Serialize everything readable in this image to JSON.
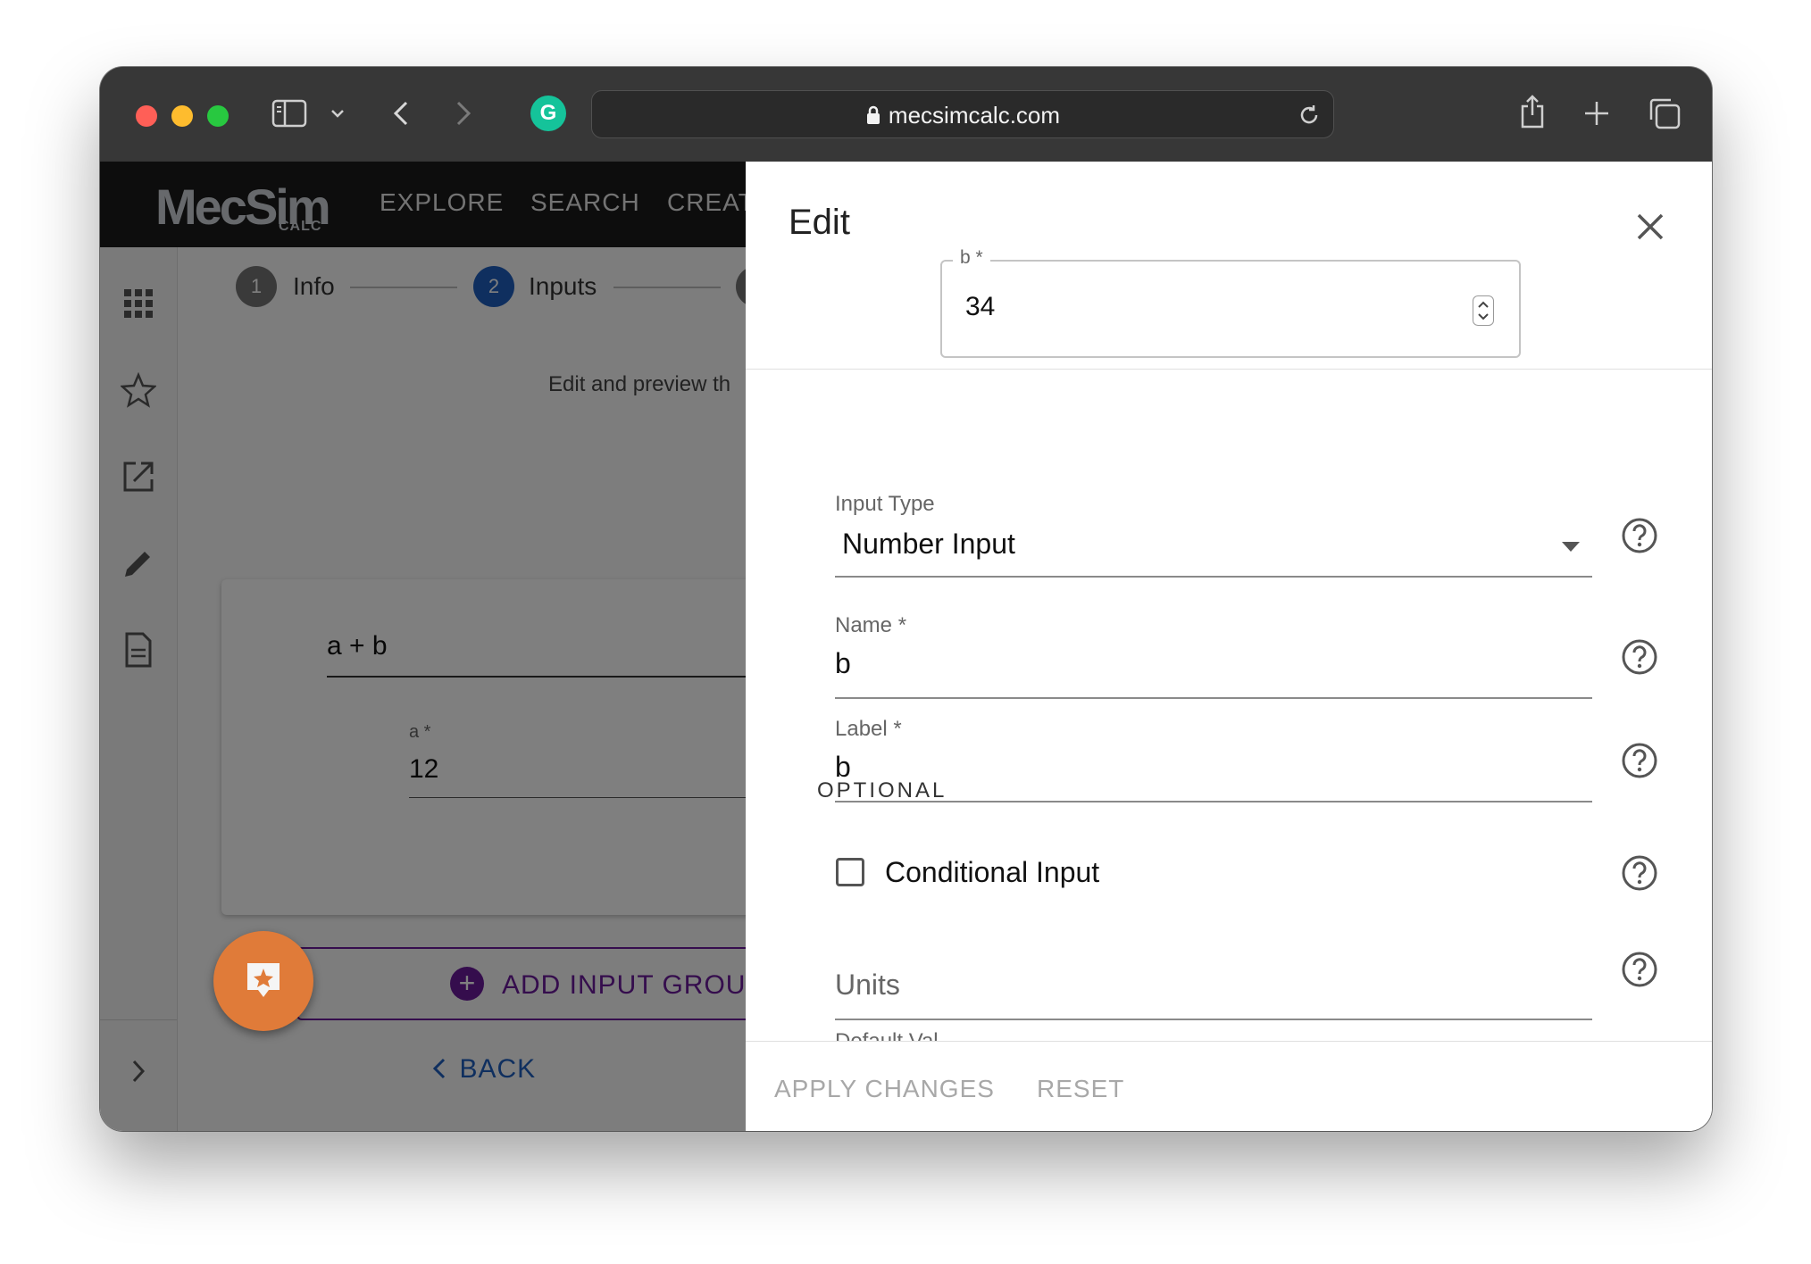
{
  "browser": {
    "url": "mecsimcalc.com"
  },
  "app": {
    "logo_main": "MecSim",
    "logo_sub": "CALC",
    "nav": [
      "EXPLORE",
      "SEARCH",
      "CREAT"
    ]
  },
  "stepper": {
    "steps": [
      {
        "number": "1",
        "label": "Info"
      },
      {
        "number": "2",
        "label": "Inputs"
      }
    ]
  },
  "page": {
    "subtitle": "Edit and preview th",
    "group_title": "a + b",
    "input_a_label": "a *",
    "input_a_value": "12",
    "add_group_label": "ADD INPUT GROUP",
    "back_label": "BACK"
  },
  "drawer": {
    "title": "Edit",
    "preview_label": "b *",
    "preview_value": "34",
    "input_type_label": "Input Type",
    "input_type_value": "Number Input",
    "name_label": "Name *",
    "name_value": "b",
    "label_label": "Label *",
    "label_value": "b",
    "optional_heading": "OPTIONAL",
    "conditional_label": "Conditional Input",
    "units_placeholder": "Units",
    "default_value_label": "Default Val",
    "apply_label": "APPLY CHANGES",
    "reset_label": "RESET"
  },
  "colors": {
    "step_active": "#1e5fbf",
    "step_inactive": "#757575",
    "purple": "#6a1b9a",
    "fab": "#e07b39",
    "link_blue": "#1e5fbf"
  }
}
